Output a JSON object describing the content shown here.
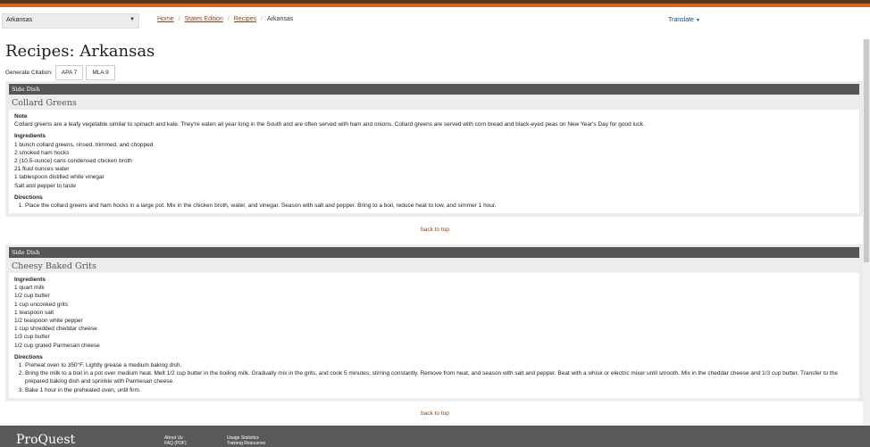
{
  "state_select": {
    "value": "Arkansas"
  },
  "breadcrumb": {
    "home": "Home",
    "edition": "States Edition",
    "recipes": "Recipes",
    "current": "Arkansas"
  },
  "translate": {
    "label": "Translate"
  },
  "page_title": "Recipes: Arkansas",
  "citation": {
    "label": "Generate Citation:",
    "apa": "APA 7",
    "mla": "MLA 9"
  },
  "recipes": [
    {
      "category": "Side Dish",
      "title": "Collard Greens",
      "note_heading": "Note",
      "note": "Collard greens are a leafy vegetable similar to spinach and kale. They're eaten all year long in the South and are often served with ham and onions. Collard greens are served with corn bread and black-eyed peas on New Year's Day for good luck.",
      "ingredients_heading": "Ingredients",
      "ingredients": [
        "1 bunch collard greens, rinsed, trimmed, and chopped",
        "2 smoked ham hocks",
        "2 (10.5-ounce) cans condensed chicken broth",
        "21 fluid ounces water",
        "1 tablespoon distilled white vinegar",
        "Salt and pepper to taste"
      ],
      "directions_heading": "Directions",
      "directions": [
        "Place the collard greens and ham hocks in a large pot. Mix in the chicken broth, water, and vinegar. Season with salt and pepper. Bring to a boil, reduce heat to low, and simmer 1 hour."
      ]
    },
    {
      "category": "Side Dish",
      "title": "Cheesy Baked Grits",
      "ingredients_heading": "Ingredients",
      "ingredients": [
        "1 quart milk",
        "1/2 cup butter",
        "1 cup uncooked grits",
        "1 teaspoon salt",
        "1/2 teaspoon white pepper",
        "1 cup shredded cheddar cheese",
        "1/3 cup butter",
        "1/2 cup grated Parmesan cheese"
      ],
      "directions_heading": "Directions",
      "directions": [
        "Preheat oven to 350°F. Lightly grease a medium baking dish.",
        "Bring the milk to a boil in a pot over medium heat. Melt 1/2 cup butter in the boiling milk. Gradually mix in the grits, and cook 5 minutes, stirring constantly. Remove from heat, and season with salt and pepper. Beat with a whisk or electric mixer until smooth. Mix in the cheddar cheese and 1/3 cup butter. Transfer to the prepared baking dish and sprinkle with Parmesan cheese.",
        "Bake 1 hour in the preheated oven, until firm."
      ]
    }
  ],
  "back_to_top": "back to top",
  "footer": {
    "logo": "ProQuest",
    "links_col1": [
      "About Us",
      "FAQ (PDF)"
    ],
    "links_col2": [
      "Usage Statistics",
      "Training Resources"
    ]
  }
}
